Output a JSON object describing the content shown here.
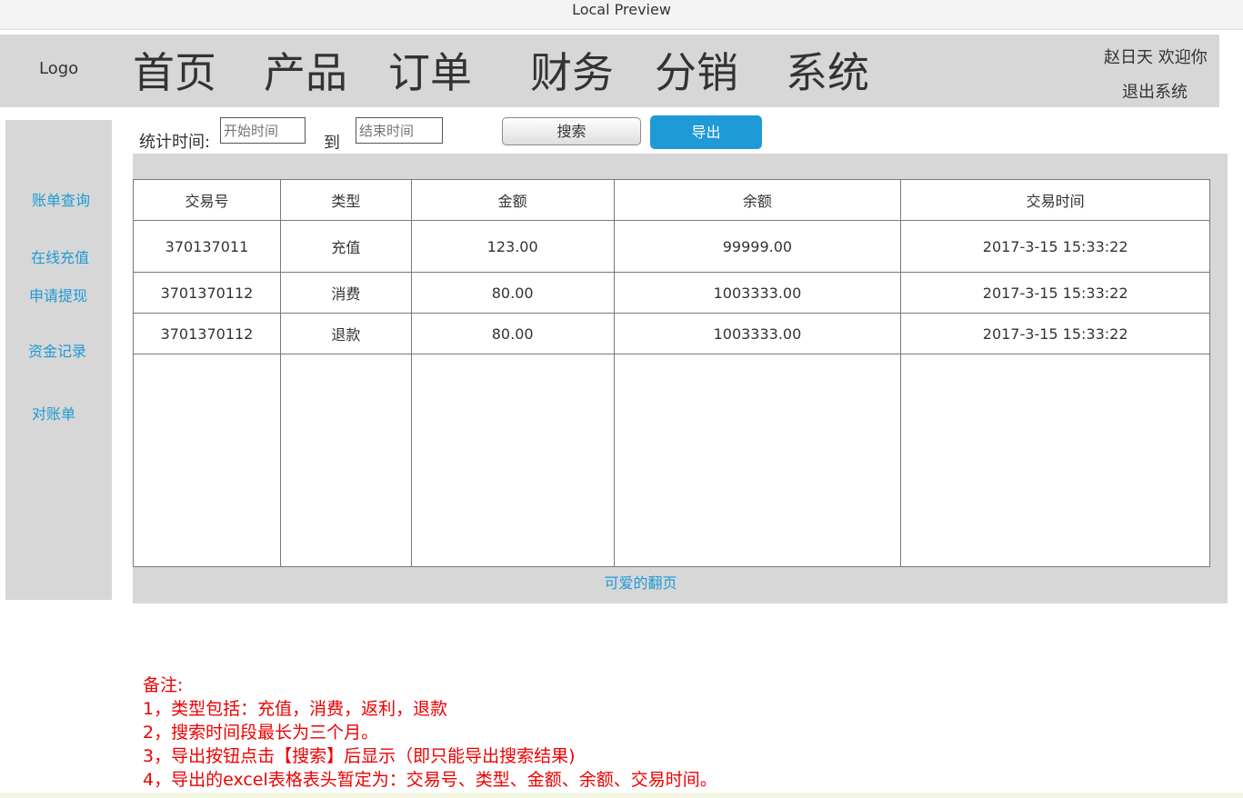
{
  "window": {
    "title": "Local Preview"
  },
  "header": {
    "logo": "Logo",
    "nav": [
      "首页",
      "产品",
      "订单",
      "财务",
      "分销",
      "系统"
    ],
    "user_greeting": "赵日天 欢迎你",
    "logout": "退出系统"
  },
  "sidebar": {
    "items": [
      "账单查询",
      "在线充值",
      "申请提现",
      "资金记录",
      "对账单"
    ]
  },
  "filter": {
    "label": "统计时间:",
    "start_placeholder": "开始时间",
    "to_label": "到",
    "end_placeholder": "结束时间",
    "search_label": "搜索",
    "export_label": "导出"
  },
  "table": {
    "columns": [
      "交易号",
      "类型",
      "金额",
      "余额",
      "交易时间"
    ],
    "rows": [
      [
        "370137011",
        "充值",
        "123.00",
        "99999.00",
        "2017-3-15 15:33:22"
      ],
      [
        "3701370112",
        "消费",
        "80.00",
        "1003333.00",
        "2017-3-15 15:33:22"
      ],
      [
        "3701370112",
        "退款",
        "80.00",
        "1003333.00",
        "2017-3-15 15:33:22"
      ]
    ]
  },
  "pager": {
    "label": "可爱的翻页"
  },
  "notes": {
    "lines": [
      "备注:",
      "1，类型包括：充值，消费，返利，退款",
      "2，搜索时间段最长为三个月。",
      "3，导出按钮点击【搜索】后显示（即只能导出搜索结果)",
      "4，导出的excel表格表头暂定为：交易号、类型、金额、余额、交易时间。"
    ]
  },
  "colors": {
    "accent": "#1e9ad6",
    "panel": "#d7d7d7",
    "note": "#ee0000"
  }
}
